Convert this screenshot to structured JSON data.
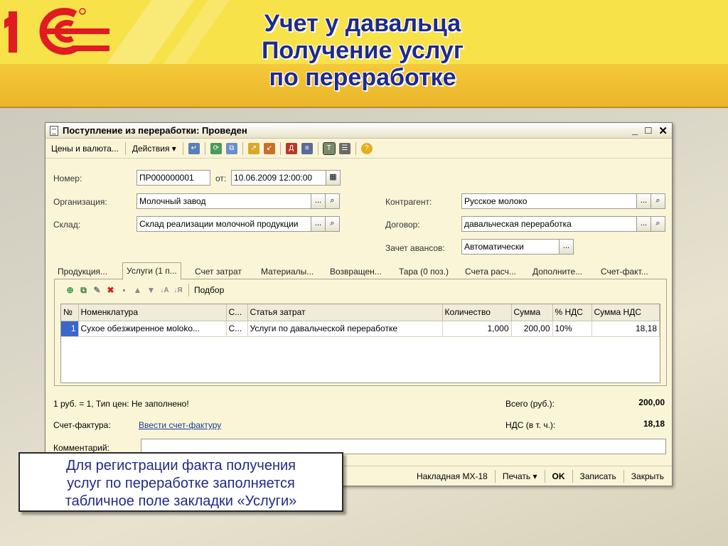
{
  "slide": {
    "logo_text": "1С",
    "title_lines": [
      "Учет у давальца",
      "Получение услуг",
      "по переработке"
    ],
    "callout_lines": [
      "Для регистрации факта получения",
      "услуг по переработке заполняется",
      "табличное поле закладки «Услуги»"
    ]
  },
  "window": {
    "title": "Поступление из переработки: Проведен",
    "controls": {
      "minimize": "_",
      "maximize": "□",
      "close": "✕"
    }
  },
  "toolbar": {
    "prices_label": "Цены и валюта...",
    "actions_label": "Действия"
  },
  "form": {
    "number_label": "Номер:",
    "number_value": "ПР000000001",
    "from_label": "от:",
    "date_value": "10.06.2009 12:00:00",
    "org_label": "Организация:",
    "org_value": "Молочный завод",
    "warehouse_label": "Склад:",
    "warehouse_value": "Склад реализации молочной продукции",
    "counterparty_label": "Контрагент:",
    "counterparty_value": "Русское молоко",
    "contract_label": "Договор:",
    "contract_value": "давальческая переработка",
    "advances_label": "Зачет авансов:",
    "advances_value": "Автоматически",
    "ellipsis": "...",
    "search_glyph": "🔍"
  },
  "tabs": [
    "Продукция...",
    "Услуги (1 п...",
    "Счет затрат",
    "Материалы...",
    "Возвращен...",
    "Тара (0 поз.)",
    "Счета расч...",
    "Дополните...",
    "Счет-факт..."
  ],
  "tab_toolbar": {
    "pick_label": "Подбор"
  },
  "table": {
    "columns": [
      "№",
      "Номенклатура",
      "С...",
      "Статья затрат",
      "Количество",
      "Сумма",
      "% НДС",
      "Сумма НДС"
    ],
    "rows": [
      {
        "n": "1",
        "item": "Сухое обезжиренное моloko...",
        "c": "С...",
        "cost_item": "Услуги по давальческой переработке",
        "qty": "1,000",
        "sum": "200,00",
        "vat_rate": "10%",
        "vat_sum": "18,18"
      }
    ]
  },
  "footer": {
    "rate_text": "1 руб. = 1, Тип цен: Не заполнено!",
    "total_label": "Всего (руб.):",
    "total_value": "200,00",
    "invoice_label": "Счет-фактура:",
    "invoice_link": "Ввести счет-фактуру",
    "vat_label": "НДС (в т. ч.):",
    "vat_value": "18,18",
    "comment_label": "Комментарий:"
  },
  "bottom_buttons": {
    "waybill": "Накладная МХ-18",
    "print": "Печать",
    "ok": "OK",
    "save": "Записать",
    "close": "Закрыть"
  },
  "colors": {
    "title_blue": "#1f2a8a",
    "header_yellow": "#f7e24a",
    "logo_red": "#e01b22",
    "window_bg": "#fbf5d8",
    "selection_blue": "#3a67c9"
  }
}
